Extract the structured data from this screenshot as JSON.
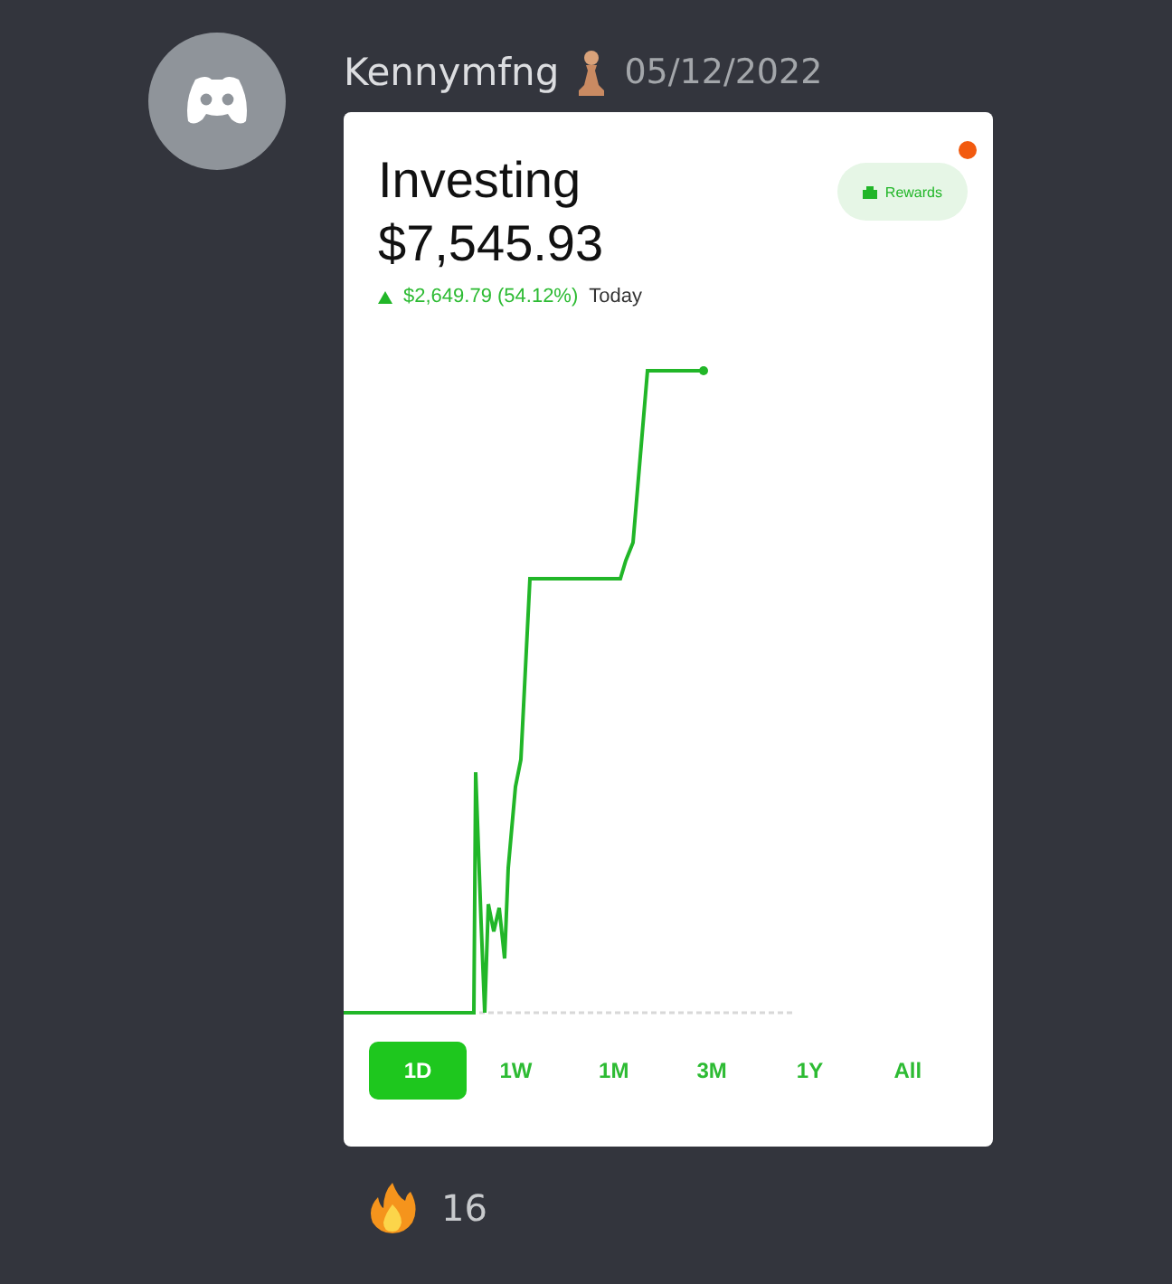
{
  "message": {
    "author": "Kennymfng",
    "timestamp": "05/12/2022"
  },
  "card": {
    "title": "Investing",
    "value": "$7,545.93",
    "change": "$2,649.79 (54.12%)",
    "change_period": "Today",
    "rewards_label": "Rewards",
    "notification": true,
    "ranges": [
      {
        "label": "1D",
        "selected": true
      },
      {
        "label": "1W",
        "selected": false
      },
      {
        "label": "1M",
        "selected": false
      },
      {
        "label": "3M",
        "selected": false
      },
      {
        "label": "1Y",
        "selected": false
      },
      {
        "label": "All",
        "selected": false
      }
    ]
  },
  "reactions": [
    {
      "count": "16"
    }
  ]
}
